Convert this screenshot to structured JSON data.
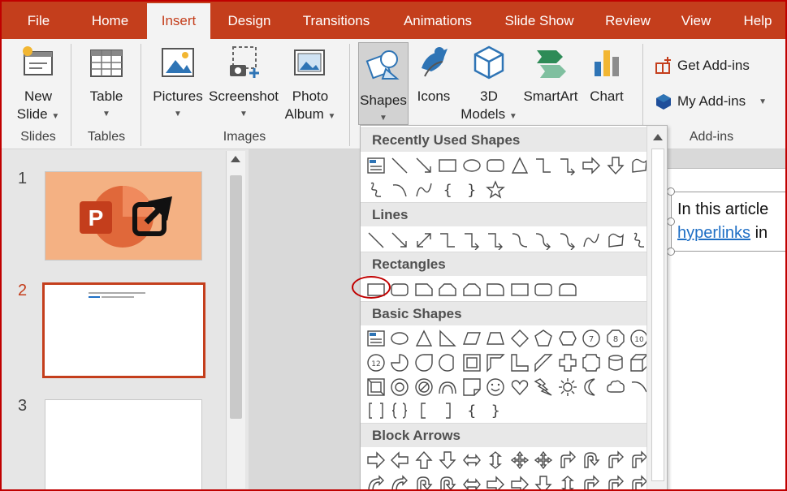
{
  "tabs": [
    "File",
    "Home",
    "Insert",
    "Design",
    "Transitions",
    "Animations",
    "Slide Show",
    "Review",
    "View",
    "Help"
  ],
  "active_tab": "Insert",
  "ribbon": {
    "new_slide": [
      "New",
      "Slide"
    ],
    "table": "Table",
    "pictures": "Pictures",
    "screenshot": "Screenshot",
    "photo_album": [
      "Photo",
      "Album"
    ],
    "shapes": "Shapes",
    "icons": "Icons",
    "models_3d": [
      "3D",
      "Models"
    ],
    "smartart": "SmartArt",
    "chart": "Chart",
    "get_addins": "Get Add-ins",
    "my_addins": "My Add-ins",
    "groups": [
      "Slides",
      "Tables",
      "Images",
      "Add-ins"
    ]
  },
  "slides": [
    "1",
    "2",
    "3"
  ],
  "selected_slide": "2",
  "slide_text": {
    "line1": "In this article",
    "link": "hyperlinks",
    "line2_rest": " in"
  },
  "dropdown": {
    "categories": [
      "Recently Used Shapes",
      "Lines",
      "Rectangles",
      "Basic Shapes",
      "Block Arrows"
    ],
    "highlighted_shape": "rectangle",
    "brace_glyphs": [
      "{",
      "}"
    ]
  },
  "colors": {
    "accent": "#c43e1c",
    "link": "#1f6fc5",
    "frame": "#c00000"
  }
}
